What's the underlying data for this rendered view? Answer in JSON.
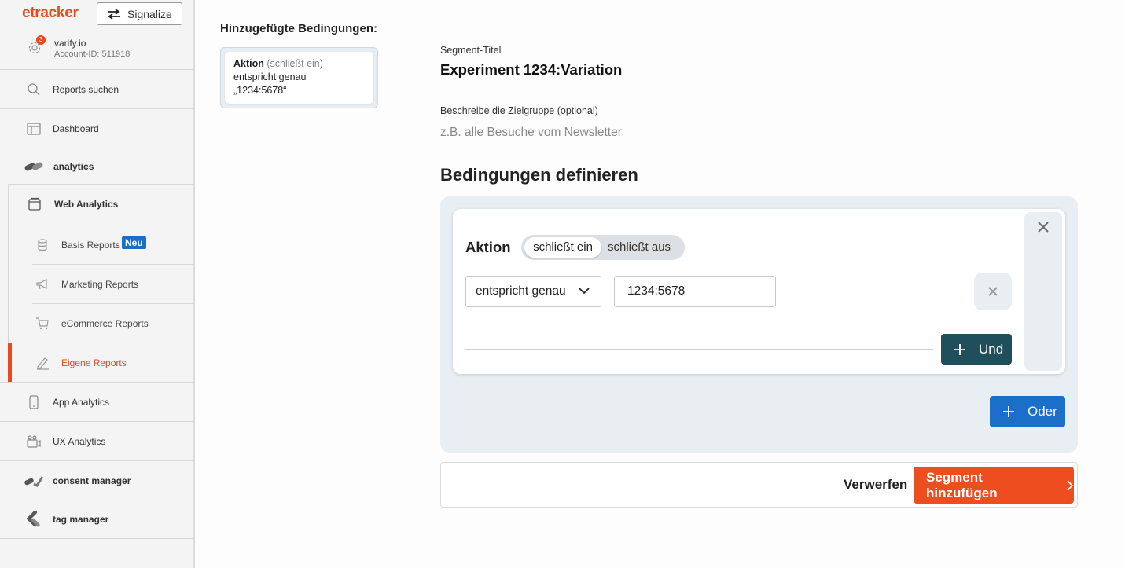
{
  "sidebar": {
    "logo": "etracker",
    "signalize_label": "Signalize",
    "account": {
      "notification_count": "3",
      "name": "varify.io",
      "id": "Account-ID: 511918"
    },
    "items": [
      {
        "label": "Reports suchen"
      },
      {
        "label": "Dashboard"
      },
      {
        "label": "analytics"
      },
      {
        "label": "App Analytics"
      },
      {
        "label": "UX Analytics"
      },
      {
        "label": "consent manager"
      },
      {
        "label": "tag manager"
      }
    ],
    "web_analytics": {
      "label": "Web Analytics",
      "items": [
        {
          "label": "Basis Reports",
          "badge": "Neu"
        },
        {
          "label": "Marketing Reports"
        },
        {
          "label": "eCommerce Reports"
        },
        {
          "label": "Eigene Reports"
        }
      ]
    }
  },
  "summary": {
    "heading": "Hinzugefügte Bedingungen:",
    "card": {
      "field": "Aktion",
      "mode": "(schließt ein)",
      "operator": "entspricht genau",
      "value": "„1234:5678“"
    }
  },
  "form": {
    "title_label": "Segment-Titel",
    "title_value": "Experiment 1234:Variation",
    "description_label": "Beschreibe die Zielgruppe (optional)",
    "description_placeholder": "z.B. alle Besuche vom Newsletter",
    "conditions_heading": "Bedingungen definieren",
    "condition": {
      "field": "Aktion",
      "include_label": "schließt ein",
      "exclude_label": "schließt aus",
      "operator": "entspricht genau",
      "value": "1234:5678"
    },
    "and_label": "Und",
    "or_label": "Oder",
    "discard_label": "Verwerfen",
    "submit_label": "Segment hinzufügen"
  },
  "colors": {
    "brand": "#e8491d",
    "primary_blue": "#1b6fc8",
    "dark_teal": "#1f4f5a",
    "submit": "#ee4e1f"
  }
}
